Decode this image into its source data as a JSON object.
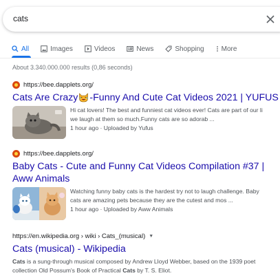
{
  "search": {
    "query": "cats"
  },
  "tabs": [
    {
      "label": "All",
      "icon": "search-icon",
      "active": true
    },
    {
      "label": "Images",
      "icon": "image-icon",
      "active": false
    },
    {
      "label": "Videos",
      "icon": "video-icon",
      "active": false
    },
    {
      "label": "News",
      "icon": "news-icon",
      "active": false
    },
    {
      "label": "Shopping",
      "icon": "tag-icon",
      "active": false
    },
    {
      "label": "More",
      "icon": "more-dots-icon",
      "active": false
    }
  ],
  "stats": "About 3.340.000.000 results (0,86 seconds)",
  "results": [
    {
      "url": "https://bee.dapplets.org/",
      "title_part1": "Cats Are Crazy",
      "title_part2": "-Funny And Cute Cat Videos 2021 | YUFUS",
      "snippet_line1": "Hi cat lovers! The best and funniest cat videos ever! Cats are part of our li",
      "snippet_line2": "we laugh at them so much.Funny cats are so adorab ...",
      "meta": "1 hour ago · Uploaded by Yufus"
    },
    {
      "url": "https://bee.dapplets.org/",
      "title": "Baby Cats - Cute and Funny Cat Videos Compilation #37 | Aww Animals",
      "snippet_line1": "Watching funny baby cats is the hardest try not to laugh challenge. Baby",
      "snippet_line2": "cats are amazing pets because they are the cutest and mos ...",
      "meta": "1 hour ago · Uploaded by Aww Animals"
    },
    {
      "breadcrumb": "https://en.wikipedia.org › wiki › Cats_(musical)",
      "title": "Cats (musical) - Wikipedia",
      "snippet_line1_bold": "Cats",
      "snippet_line1_rest": " is a sung-through musical composed by Andrew Lloyd Webber, based on the 1939 poet",
      "snippet_line2_start": "collection Old Possum's Book of Practical ",
      "snippet_line2_bold": "Cats",
      "snippet_line2_end": " by T. S. Eliot."
    }
  ],
  "colors": {
    "link": "#1a0dab",
    "accent": "#1a73e8",
    "muted": "#70757a",
    "snippet": "#4d5156"
  }
}
